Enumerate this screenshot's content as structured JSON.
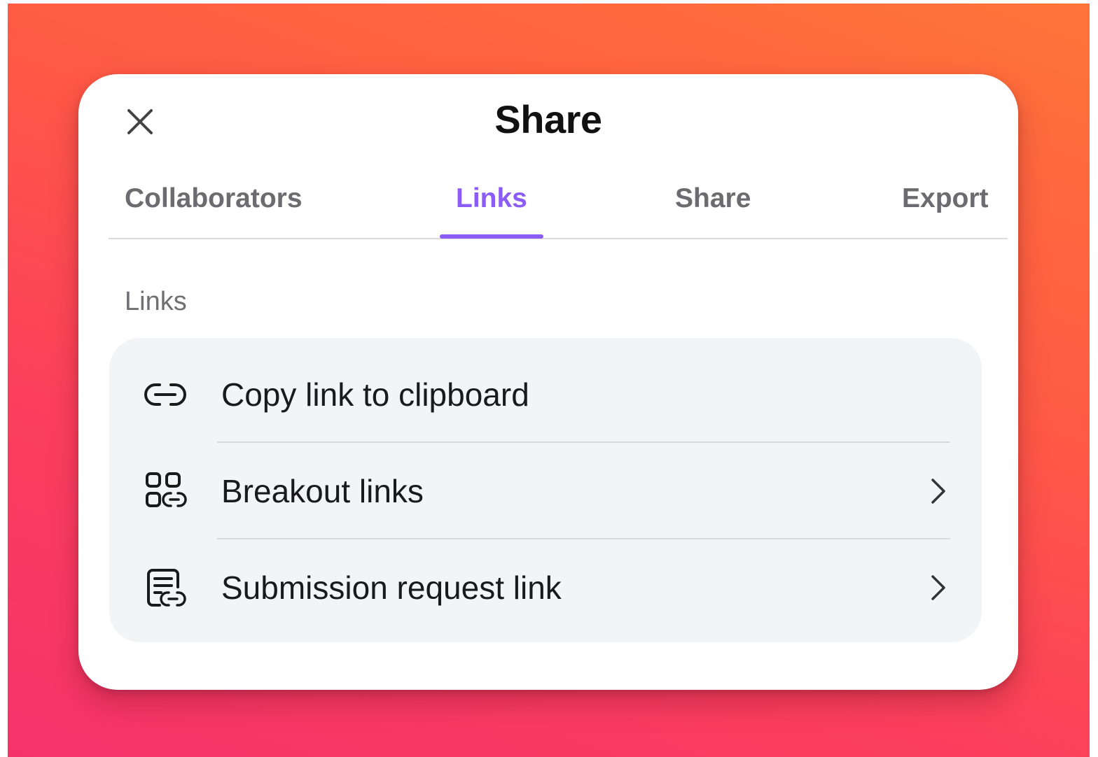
{
  "dialog": {
    "title": "Share",
    "close_icon": "close-icon"
  },
  "tabs": [
    {
      "label": "Collaborators",
      "active": false
    },
    {
      "label": "Links",
      "active": true
    },
    {
      "label": "Share",
      "active": false
    },
    {
      "label": "Export",
      "active": false
    }
  ],
  "section": {
    "label": "Links"
  },
  "items": [
    {
      "label": "Copy link to clipboard",
      "icon": "link-icon",
      "has_chevron": false
    },
    {
      "label": "Breakout links",
      "icon": "breakout-grid-link-icon",
      "has_chevron": true
    },
    {
      "label": "Submission request link",
      "icon": "form-link-icon",
      "has_chevron": true
    }
  ],
  "colors": {
    "accent": "#8b5cf6",
    "background_gradient_start": "#ff7438",
    "background_gradient_end": "#f5336b",
    "card_background": "#f3f4f6"
  }
}
